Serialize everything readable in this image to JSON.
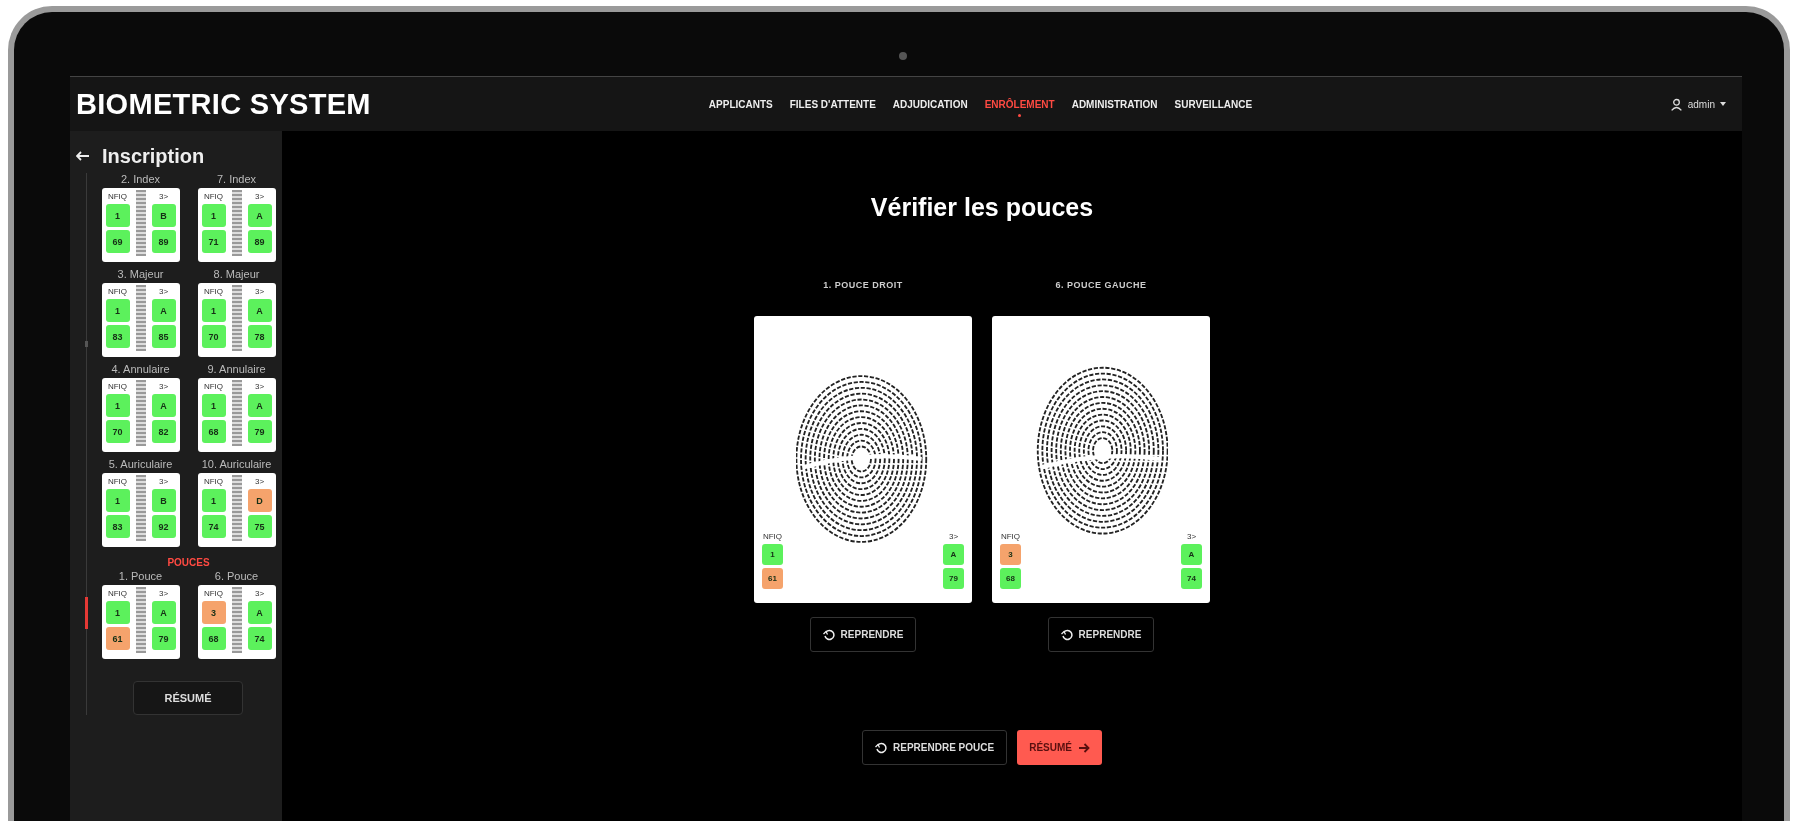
{
  "header": {
    "title": "BIOMETRIC SYSTEM",
    "nav": [
      {
        "label": "APPLICANTS",
        "selected": false
      },
      {
        "label": "FILES D'ATTENTE",
        "selected": false
      },
      {
        "label": "ADJUDICATION",
        "selected": false
      },
      {
        "label": "ENRÔLEMENT",
        "selected": true
      },
      {
        "label": "ADMINISTRATION",
        "selected": false
      },
      {
        "label": "SURVEILLANCE",
        "selected": false
      }
    ],
    "user": "admin"
  },
  "sidebar": {
    "title": "Inscription",
    "sections": [
      {
        "current": false,
        "fingers": [
          {
            "label": "2. Index",
            "tags": [
              "NFIQ",
              "3>"
            ],
            "scores": [
              {
                "text": "1",
                "warning": false
              },
              {
                "text": "B",
                "warning": false
              },
              {
                "text": "69",
                "warning": false
              },
              {
                "text": "89",
                "warning": false
              }
            ]
          },
          {
            "label": "7. Index",
            "tags": [
              "NFIQ",
              "3>"
            ],
            "scores": [
              {
                "text": "1",
                "warning": false
              },
              {
                "text": "A",
                "warning": false
              },
              {
                "text": "71",
                "warning": false
              },
              {
                "text": "89",
                "warning": false
              }
            ]
          },
          {
            "label": "3. Majeur",
            "tags": [
              "NFIQ",
              "3>"
            ],
            "scores": [
              {
                "text": "1",
                "warning": false
              },
              {
                "text": "A",
                "warning": false
              },
              {
                "text": "83",
                "warning": false
              },
              {
                "text": "85",
                "warning": false
              }
            ]
          },
          {
            "label": "8. Majeur",
            "tags": [
              "NFIQ",
              "3>"
            ],
            "scores": [
              {
                "text": "1",
                "warning": false
              },
              {
                "text": "A",
                "warning": false
              },
              {
                "text": "70",
                "warning": false
              },
              {
                "text": "78",
                "warning": false
              }
            ]
          },
          {
            "label": "4. Annulaire",
            "tags": [
              "NFIQ",
              "3>"
            ],
            "scores": [
              {
                "text": "1",
                "warning": false
              },
              {
                "text": "A",
                "warning": false
              },
              {
                "text": "70",
                "warning": false
              },
              {
                "text": "82",
                "warning": false
              }
            ]
          },
          {
            "label": "9. Annulaire",
            "tags": [
              "NFIQ",
              "3>"
            ],
            "scores": [
              {
                "text": "1",
                "warning": false
              },
              {
                "text": "A",
                "warning": false
              },
              {
                "text": "68",
                "warning": false
              },
              {
                "text": "79",
                "warning": false
              }
            ]
          },
          {
            "label": "5. Auriculaire",
            "tags": [
              "NFIQ",
              "3>"
            ],
            "scores": [
              {
                "text": "1",
                "warning": false
              },
              {
                "text": "B",
                "warning": false
              },
              {
                "text": "83",
                "warning": false
              },
              {
                "text": "92",
                "warning": false
              }
            ]
          },
          {
            "label": "10. Auriculaire",
            "tags": [
              "NFIQ",
              "3>"
            ],
            "scores": [
              {
                "text": "1",
                "warning": false
              },
              {
                "text": "D",
                "warning": true
              },
              {
                "text": "74",
                "warning": false
              },
              {
                "text": "75",
                "warning": false
              }
            ]
          }
        ]
      },
      {
        "heading": "POUCES",
        "current": true,
        "fingers": [
          {
            "label": "1. Pouce",
            "tags": [
              "NFIQ",
              "3>"
            ],
            "scores": [
              {
                "text": "1",
                "warning": false
              },
              {
                "text": "A",
                "warning": false
              },
              {
                "text": "61",
                "warning": true
              },
              {
                "text": "79",
                "warning": false
              }
            ]
          },
          {
            "label": "6. Pouce",
            "tags": [
              "NFIQ",
              "3>"
            ],
            "scores": [
              {
                "text": "3",
                "warning": true
              },
              {
                "text": "A",
                "warning": false
              },
              {
                "text": "68",
                "warning": false
              },
              {
                "text": "74",
                "warning": false
              }
            ]
          }
        ]
      }
    ],
    "summary_button": "RÉSUMÉ"
  },
  "main": {
    "title": "Vérifier les pouces",
    "thumbs": [
      {
        "label": "1. POUCE DROIT",
        "tags": [
          "NFIQ",
          "3>"
        ],
        "scores": [
          {
            "text": "1",
            "warning": false
          },
          {
            "text": "A",
            "warning": false
          },
          {
            "text": "61",
            "warning": true
          },
          {
            "text": "79",
            "warning": false
          }
        ],
        "retake": "REPRENDRE"
      },
      {
        "label": "6. POUCE GAUCHE",
        "tags": [
          "NFIQ",
          "3>"
        ],
        "scores": [
          {
            "text": "3",
            "warning": true
          },
          {
            "text": "A",
            "warning": false
          },
          {
            "text": "68",
            "warning": false
          },
          {
            "text": "74",
            "warning": false
          }
        ],
        "retake": "REPRENDRE"
      }
    ],
    "actions": [
      {
        "label": "REPRENDRE POUCE",
        "kind": "secondary"
      },
      {
        "label": "RÉSUMÉ",
        "kind": "primary"
      }
    ]
  }
}
